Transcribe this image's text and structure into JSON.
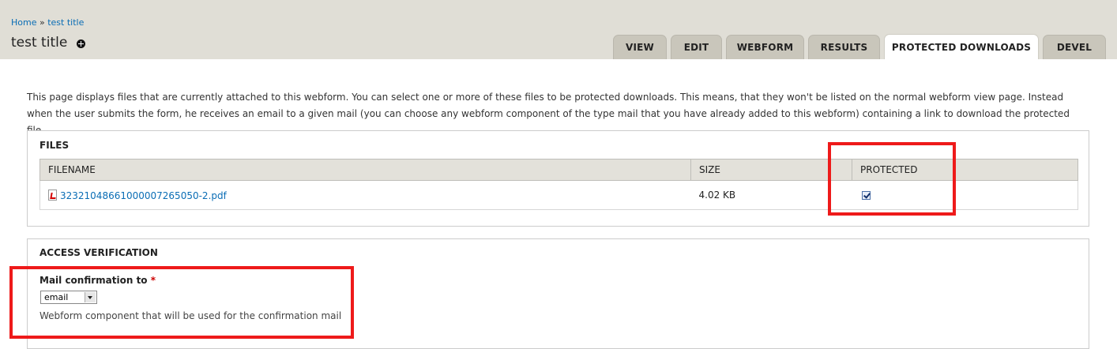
{
  "breadcrumb": {
    "home": "Home",
    "separator": "»",
    "current": "test title"
  },
  "page_title": "test title",
  "tabs": [
    {
      "label": "VIEW"
    },
    {
      "label": "EDIT"
    },
    {
      "label": "WEBFORM"
    },
    {
      "label": "RESULTS"
    },
    {
      "label": "PROTECTED DOWNLOADS",
      "active": true
    },
    {
      "label": "DEVEL"
    }
  ],
  "intro_text": "This page displays files that are currently attached to this webform. You can select one or more of these files to be protected downloads. This means, that they won't be listed on the normal webform view page. Instead when the user submits the form, he receives an email to a given mail (you can choose any webform component of the type mail that you have already added to this webform) containing a link to download the protected file.",
  "files": {
    "legend": "FILES",
    "columns": [
      "FILENAME",
      "SIZE",
      "PROTECTED"
    ],
    "rows": [
      {
        "filename": "32321048661000007265050-2.pdf",
        "size": "4.02 KB",
        "protected": true
      }
    ]
  },
  "access": {
    "legend": "ACCESS VERIFICATION",
    "label": "Mail confirmation to",
    "required_marker": "*",
    "selected": "email",
    "description": "Webform component that will be used for the confirmation mail"
  },
  "colors": {
    "link": "#0a6db5",
    "highlight": "#ee1a1a",
    "header_bg": "#e0ded6"
  }
}
